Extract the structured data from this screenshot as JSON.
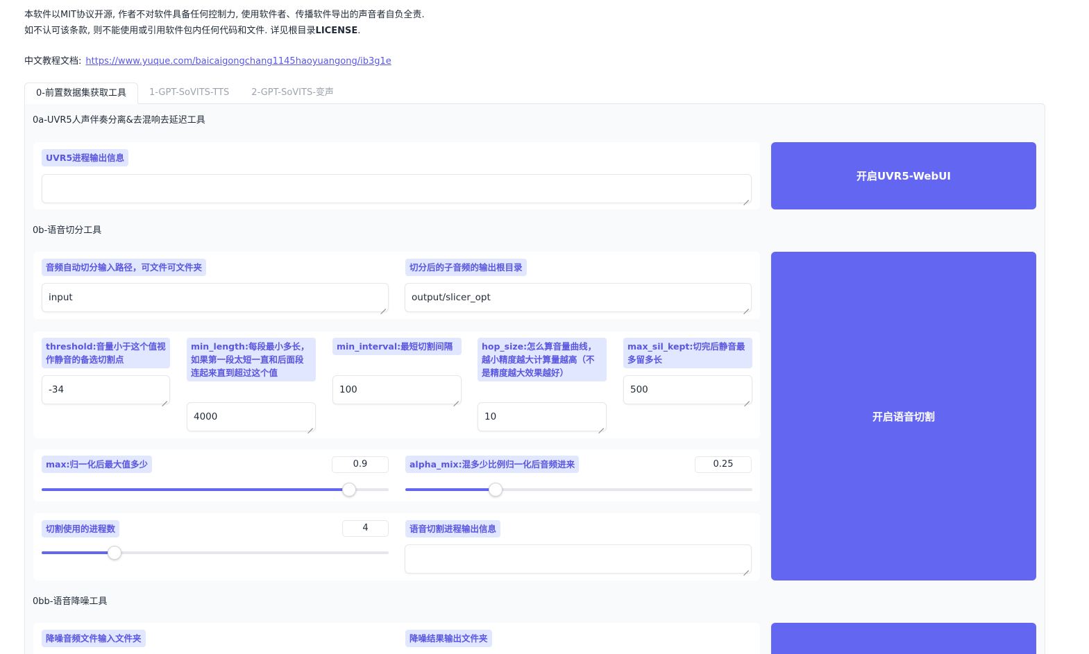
{
  "notice": {
    "line1": "本软件以MIT协议开源, 作者不对软件具备任何控制力, 使用软件者、传播软件导出的声音者自负全责.",
    "line2_prefix": "如不认可该条款, 则不能使用或引用软件包内任何代码和文件. 详见根目录",
    "line2_license": "LICENSE",
    "line2_suffix": "."
  },
  "doc": {
    "label": "中文教程文档:",
    "link": "https://www.yuque.com/baicaigongchang1145haoyuangong/ib3g1e"
  },
  "tabs": [
    {
      "label": "0-前置数据集获取工具",
      "active": true
    },
    {
      "label": "1-GPT-SoVITS-TTS",
      "active": false
    },
    {
      "label": "2-GPT-SoVITS-变声",
      "active": false
    }
  ],
  "uvr5": {
    "section_title": "0a-UVR5人声伴奏分离&去混响去延迟工具",
    "output_label": "UVR5进程输出信息",
    "output_value": "",
    "button": "开启UVR5-WebUI"
  },
  "slicer": {
    "section_title": "0b-语音切分工具",
    "input_path_label": "音频自动切分输入路径，可文件可文件夹",
    "input_path_value": "input",
    "output_dir_label": "切分后的子音频的输出根目录",
    "output_dir_value": "output/slicer_opt",
    "threshold_label": "threshold:音量小于这个值视作静音的备选切割点",
    "threshold_value": "-34",
    "min_length_label": "min_length:每段最小多长，如果第一段太短一直和后面段连起来直到超过这个值",
    "min_length_value": "4000",
    "min_interval_label": "min_interval:最短切割间隔",
    "min_interval_value": "100",
    "hop_size_label": "hop_size:怎么算音量曲线，越小精度越大计算量越高（不是精度越大效果越好）",
    "hop_size_value": "10",
    "max_sil_kept_label": "max_sil_kept:切完后静音最多留多长",
    "max_sil_kept_value": "500",
    "max_label": "max:归一化后最大值多少",
    "max_value": "0.9",
    "max_fraction": 0.885,
    "alpha_mix_label": "alpha_mix:混多少比例归一化后音频进来",
    "alpha_mix_value": "0.25",
    "alpha_fraction": 0.26,
    "n_process_label": "切割使用的进程数",
    "n_process_value": "4",
    "n_process_fraction": 0.21,
    "output_label": "语音切割进程输出信息",
    "output_value": "",
    "button": "开启语音切割"
  },
  "denoise": {
    "section_title": "0bb-语音降噪工具",
    "input_label": "降噪音频文件输入文件夹",
    "output_label": "降噪结果输出文件夹"
  },
  "colors": {
    "accent": "#6366f1",
    "label_bg": "#e0e7ff",
    "label_text": "#5b56e0"
  }
}
